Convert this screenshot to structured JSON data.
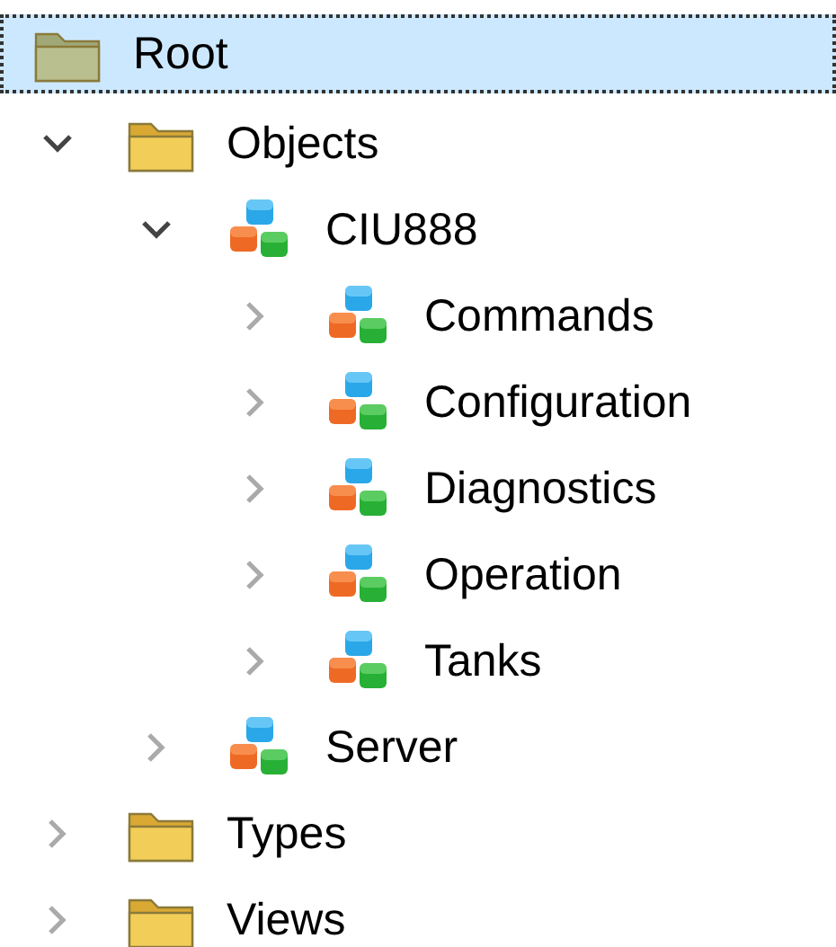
{
  "tree": {
    "label": "Root",
    "kind": "folder",
    "selected": true,
    "children": [
      {
        "label": "Objects",
        "kind": "folder",
        "selected": false,
        "expanded": true,
        "children": [
          {
            "label": "CIU888",
            "kind": "object",
            "selected": false,
            "expanded": true,
            "children": [
              {
                "label": "Commands",
                "kind": "object",
                "selected": false,
                "expanded": false
              },
              {
                "label": "Configuration",
                "kind": "object",
                "selected": false,
                "expanded": false
              },
              {
                "label": "Diagnostics",
                "kind": "object",
                "selected": false,
                "expanded": false
              },
              {
                "label": "Operation",
                "kind": "object",
                "selected": false,
                "expanded": false
              },
              {
                "label": "Tanks",
                "kind": "object",
                "selected": false,
                "expanded": false
              }
            ]
          },
          {
            "label": "Server",
            "kind": "object",
            "selected": false,
            "expanded": false
          }
        ]
      },
      {
        "label": "Types",
        "kind": "folder",
        "selected": false,
        "expanded": false
      },
      {
        "label": "Views",
        "kind": "folder",
        "selected": false,
        "expanded": false
      }
    ]
  }
}
